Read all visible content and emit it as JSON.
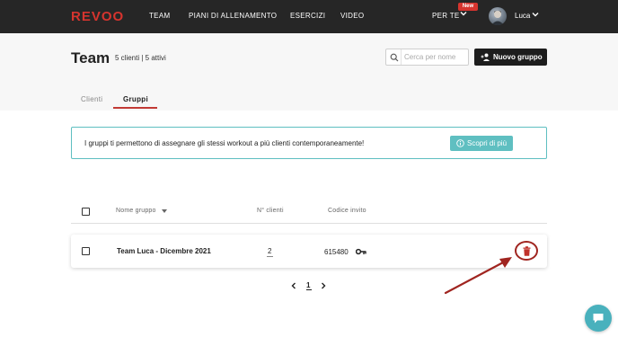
{
  "nav": {
    "logo": "REVOO",
    "items": [
      "TEAM",
      "PIANI DI ALLENAMENTO",
      "ESERCIZI",
      "VIDEO"
    ],
    "per_te": "PER TE",
    "new_badge": "New",
    "user_name": "Luca"
  },
  "header": {
    "title": "Team",
    "subtitle": "5 clienti | 5 attivi",
    "search_placeholder": "Cerca per nome",
    "new_group_label": "Nuovo gruppo"
  },
  "tabs": [
    {
      "label": "Clienti",
      "active": false
    },
    {
      "label": "Gruppi",
      "active": true
    }
  ],
  "banner": {
    "text": "I gruppi ti permettono di assegnare gli stessi workout a più clienti contemporaneamente!",
    "button_label": "Scopri di più"
  },
  "table": {
    "columns": [
      "Nome gruppo",
      "N° clienti",
      "Codice invito"
    ],
    "rows": [
      {
        "name": "Team Luca - Dicembre 2021",
        "clients": "2",
        "code": "615480"
      }
    ]
  },
  "pagination": {
    "current": "1"
  },
  "colors": {
    "brand_red": "#d6342e",
    "accent_teal": "#5fbfc1",
    "annotation_red": "#a02520",
    "nav_bg": "#262626"
  },
  "icons": {
    "search": "search-icon",
    "add_user": "add-user-icon",
    "info": "info-icon",
    "key": "key-icon",
    "trash": "trash-icon",
    "chat": "chat-icon"
  }
}
